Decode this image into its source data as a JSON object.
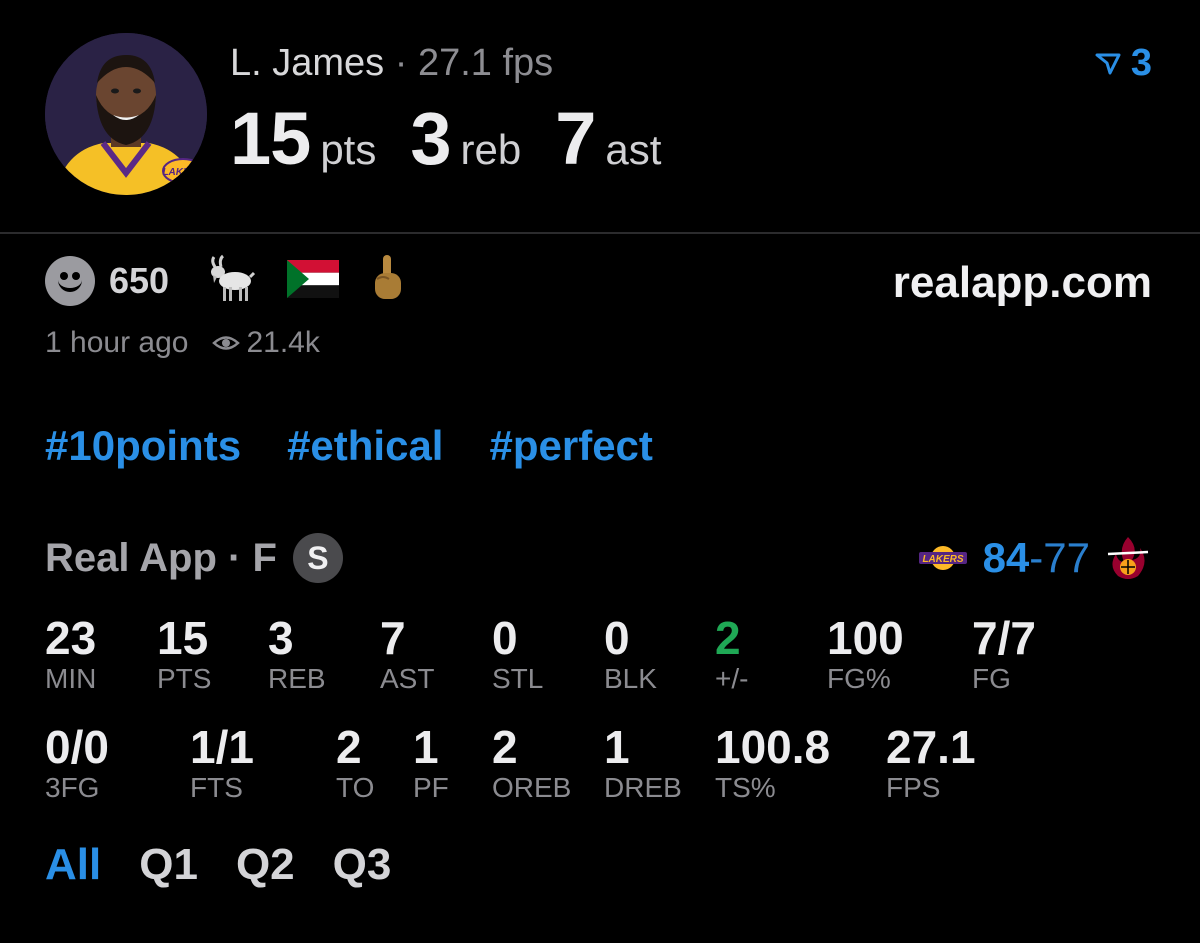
{
  "player": {
    "name": "L. James",
    "separator": "·",
    "fps": "27.1 fps",
    "stats": [
      {
        "value": "15",
        "unit": "pts"
      },
      {
        "value": "3",
        "unit": "reb"
      },
      {
        "value": "7",
        "unit": "ast"
      }
    ],
    "avatar_jersey_text": "LAKERS"
  },
  "header_badge": {
    "count": "3",
    "icon": "filter-arrow-icon"
  },
  "reactions": {
    "count": "650",
    "icons": [
      "smiley-icon",
      "goat-emoji",
      "flag-emoji",
      "middle-finger-emoji"
    ]
  },
  "site": "realapp.com",
  "meta": {
    "time": "1 hour ago",
    "views": "21.4k"
  },
  "tags": [
    "#10points",
    "#ethical",
    "#perfect"
  ],
  "game": {
    "source": "Real App",
    "status_sep": "·",
    "status": "F",
    "badge": "S",
    "home_score": "84",
    "dash": "-",
    "away_score": "77",
    "home_logo_text": "LAKERS"
  },
  "box_row1": [
    {
      "value": "23",
      "label": "MIN"
    },
    {
      "value": "15",
      "label": "PTS"
    },
    {
      "value": "3",
      "label": "REB"
    },
    {
      "value": "7",
      "label": "AST"
    },
    {
      "value": "0",
      "label": "STL"
    },
    {
      "value": "0",
      "label": "BLK"
    },
    {
      "value": "2",
      "label": "+/-"
    },
    {
      "value": "100",
      "label": "FG%"
    },
    {
      "value": "7/7",
      "label": "FG"
    }
  ],
  "box_row2": [
    {
      "value": "0/0",
      "label": "3FG"
    },
    {
      "value": "1/1",
      "label": "FTS"
    },
    {
      "value": "2",
      "label": "TO"
    },
    {
      "value": "1",
      "label": "PF"
    },
    {
      "value": "2",
      "label": "OREB"
    },
    {
      "value": "1",
      "label": "DREB"
    },
    {
      "value": "100.8",
      "label": "TS%"
    },
    {
      "value": "27.1",
      "label": "FPS"
    }
  ],
  "quarters": [
    {
      "label": "All",
      "active": true
    },
    {
      "label": "Q1",
      "active": false
    },
    {
      "label": "Q2",
      "active": false
    },
    {
      "label": "Q3",
      "active": false
    }
  ],
  "colors": {
    "accent": "#2a8fe6",
    "positive": "#1fa855",
    "background": "#000000",
    "lakers_purple": "#552583",
    "lakers_gold": "#fdb927",
    "heat_red": "#98002e"
  }
}
